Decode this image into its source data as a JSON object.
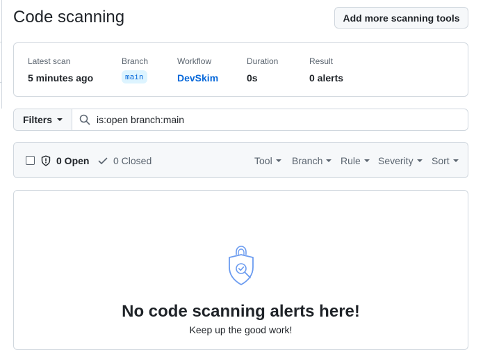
{
  "page": {
    "title": "Code scanning",
    "add_button": "Add more scanning tools"
  },
  "scan": {
    "latest_label": "Latest scan",
    "latest_value": "5 minutes ago",
    "branch_label": "Branch",
    "branch_value": "main",
    "workflow_label": "Workflow",
    "workflow_value": "DevSkim",
    "duration_label": "Duration",
    "duration_value": "0s",
    "result_label": "Result",
    "result_value": "0 alerts"
  },
  "filter": {
    "button": "Filters",
    "query": "is:open branch:main"
  },
  "alerts": {
    "open": "0 Open",
    "closed": "0 Closed",
    "menus": [
      "Tool",
      "Branch",
      "Rule",
      "Severity",
      "Sort"
    ]
  },
  "blank": {
    "title": "No code scanning alerts here!",
    "subtitle": "Keep up the good work!"
  },
  "colors": {
    "accent": "#0969da",
    "border": "#d0d7de",
    "muted": "#59636e",
    "icon_blue": "#6c9cf0"
  },
  "icons": [
    "search-icon",
    "shield-icon",
    "check-icon",
    "caret-down-icon",
    "shield-check-icon"
  ]
}
